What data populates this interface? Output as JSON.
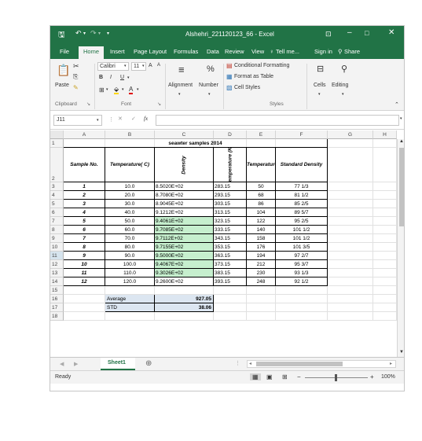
{
  "window": {
    "title": "Alshehri_221120123_66 - Excel",
    "accent_color": "#217346"
  },
  "quick_access": [
    "save-icon",
    "undo-icon",
    "redo-icon",
    "customize-icon"
  ],
  "tabs": [
    "File",
    "Home",
    "Insert",
    "Page Layout",
    "Formulas",
    "Data",
    "Review",
    "View",
    "Tell me...",
    "Sign in",
    "Share"
  ],
  "ribbon": {
    "paste_label": "Paste",
    "font_name": "Calibri",
    "font_size": "11",
    "bold": "B",
    "italic": "I",
    "underline": "U",
    "grow_font": "A",
    "shrink_font": "A",
    "alignment_label": "Alignment",
    "number_label": "Number",
    "number_symbol": "%",
    "conditional_formatting": "Conditional Formatting",
    "format_as_table": "Format as Table",
    "cell_styles": "Cell Styles",
    "cells_label": "Cells",
    "editing_label": "Editing",
    "groups": [
      "Clipboard",
      "Font",
      "Styles"
    ]
  },
  "formula_bar": {
    "name_box": "J11",
    "fx": "fx",
    "value": ""
  },
  "columns": [
    "A",
    "B",
    "C",
    "D",
    "E",
    "F",
    "G",
    "H"
  ],
  "rows": [
    "1",
    "2",
    "3",
    "4",
    "5",
    "6",
    "7",
    "8",
    "9",
    "10",
    "11",
    "12",
    "13",
    "14",
    "15",
    "16",
    "17",
    "18"
  ],
  "selected_row": "11",
  "sheet": {
    "title": "seawter samples 2014",
    "headers": {
      "sample_no": "Sample No.",
      "temperature_c": "Temperature( C)",
      "density": "Density",
      "temperature_k": "Temperature (K)",
      "temperature_f": "Temperature (F)",
      "standard_density": "Standard Density"
    },
    "data": [
      {
        "n": "1",
        "tc": "10.0",
        "d": "8.5020E+02",
        "tk": "283.15",
        "tf": "50",
        "sd": "77 1/3",
        "hl": false
      },
      {
        "n": "2",
        "tc": "20.0",
        "d": "8.7080E+02",
        "tk": "293.15",
        "tf": "68",
        "sd": "81 1/2",
        "hl": false
      },
      {
        "n": "3",
        "tc": "30.0",
        "d": "8.9045E+02",
        "tk": "303.15",
        "tf": "86",
        "sd": "85 2/5",
        "hl": false
      },
      {
        "n": "4",
        "tc": "40.0",
        "d": "9.1212E+02",
        "tk": "313.15",
        "tf": "104",
        "sd": "89 5/7",
        "hl": false
      },
      {
        "n": "5",
        "tc": "50.0",
        "d": "9.4061E+02",
        "tk": "323.15",
        "tf": "122",
        "sd": "95 2/5",
        "hl": true
      },
      {
        "n": "6",
        "tc": "60.0",
        "d": "9.7085E+02",
        "tk": "333.15",
        "tf": "140",
        "sd": "101 1/2",
        "hl": true
      },
      {
        "n": "7",
        "tc": "70.0",
        "d": "9.7112E+02",
        "tk": "343.15",
        "tf": "158",
        "sd": "101 1/2",
        "hl": true
      },
      {
        "n": "8",
        "tc": "80.0",
        "d": "9.7155E+02",
        "tk": "353.15",
        "tf": "176",
        "sd": "101 3/5",
        "hl": true
      },
      {
        "n": "9",
        "tc": "90.0",
        "d": "9.5000E+02",
        "tk": "363.15",
        "tf": "194",
        "sd": "97 2/7",
        "hl": true
      },
      {
        "n": "10",
        "tc": "100.0",
        "d": "9.4067E+02",
        "tk": "373.15",
        "tf": "212",
        "sd": "95 3/7",
        "hl": true
      },
      {
        "n": "11",
        "tc": "110.0",
        "d": "9.3026E+02",
        "tk": "383.15",
        "tf": "230",
        "sd": "93 1/3",
        "hl": true
      },
      {
        "n": "12",
        "tc": "120.0",
        "d": "9.2600E+02",
        "tk": "393.15",
        "tf": "248",
        "sd": "92 1/2",
        "hl": false
      }
    ],
    "summary": [
      {
        "label": "Average",
        "value": "927.05"
      },
      {
        "label": "STD",
        "value": "38.06"
      }
    ],
    "highlight_color": "#c6efce",
    "summary_fill": "#dce6f1"
  },
  "sheet_tabs": {
    "active": "Sheet1",
    "add": "⊕"
  },
  "status": {
    "text": "Ready",
    "zoom": "100%"
  }
}
